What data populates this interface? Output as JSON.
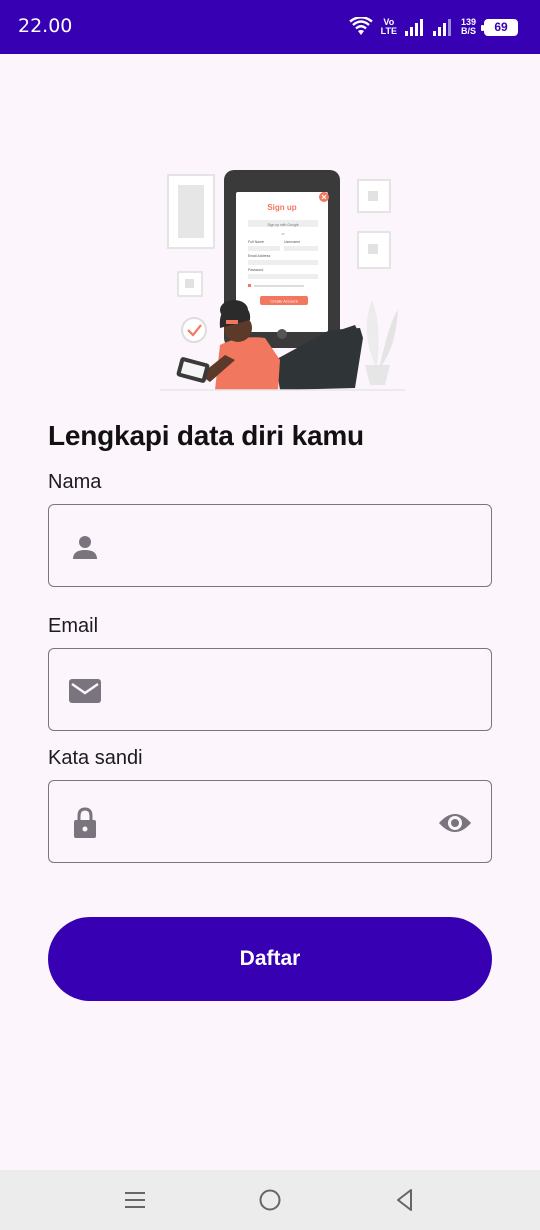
{
  "status_bar": {
    "time": "22.00",
    "volte_top": "Vo",
    "volte_bottom": "LTE",
    "speed_value": "139",
    "speed_unit": "B/S",
    "battery": "69"
  },
  "illustration": {
    "screen_title": "Sign up",
    "google_button": "Sign up with Google",
    "or": "or",
    "field_fullname": "Full Name",
    "field_username": "Username",
    "field_email": "Email Address",
    "field_password": "Password",
    "create_button": "Create Account"
  },
  "form": {
    "title": "Lengkapi data diri kamu",
    "name_label": "Nama",
    "name_value": "",
    "email_label": "Email",
    "email_value": "",
    "password_label": "Kata sandi",
    "password_value": "",
    "submit_label": "Daftar"
  },
  "icons": {
    "name": "person-icon",
    "email": "mail-icon",
    "password": "lock-icon",
    "visibility": "eye-icon"
  },
  "colors": {
    "primary": "#3700b3",
    "background": "#fcf5fc",
    "icon": "#79747e",
    "accent_illustration": "#f2775f"
  }
}
